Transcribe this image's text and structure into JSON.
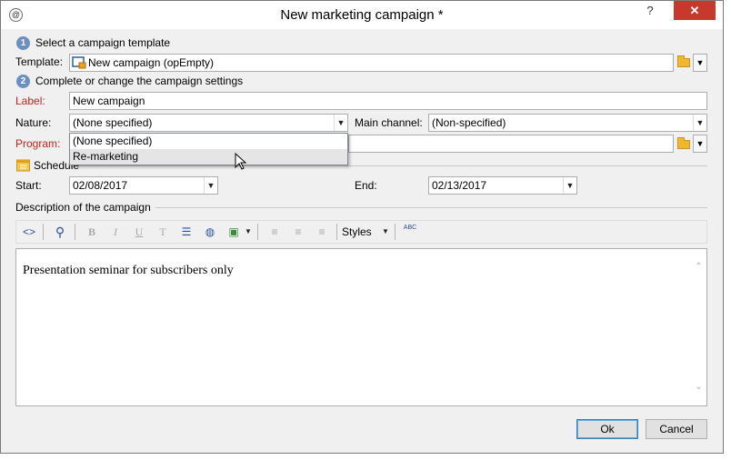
{
  "window": {
    "title": "New marketing campaign *",
    "help_glyph": "?",
    "minimize_glyph": "–",
    "close_glyph": "✕"
  },
  "steps": [
    {
      "number": "1",
      "label": "Select a campaign template"
    },
    {
      "number": "2",
      "label": "Complete or change the campaign settings"
    }
  ],
  "template": {
    "label": "Template:",
    "value": "New campaign (opEmpty)",
    "icon": "campaign-template-icon"
  },
  "fields": {
    "label": {
      "label": "Label:",
      "value": "New campaign"
    },
    "nature": {
      "label": "Nature:",
      "value": "(None specified)"
    },
    "main_channel": {
      "label": "Main channel:",
      "value": "(Non-specified)"
    },
    "program": {
      "label": "Program:",
      "value": ""
    }
  },
  "nature_dropdown": {
    "open": true,
    "options": [
      "(None specified)",
      "Re-marketing"
    ],
    "hovered_index": 1
  },
  "schedule": {
    "title": "Schedule",
    "start_label": "Start:",
    "start_value": "02/08/2017",
    "end_label": "End:",
    "end_value": "02/13/2017"
  },
  "description": {
    "title": "Description of the campaign",
    "styles_label": "Styles",
    "spell_label": "ABC",
    "text": "Presentation seminar for subscribers only"
  },
  "buttons": {
    "ok": "Ok",
    "cancel": "Cancel"
  },
  "colors": {
    "mandatory_label": "#c0241c",
    "close_button": "#c7392c",
    "step_badge": "#6b8fc0",
    "folder": "#f0b72a"
  }
}
